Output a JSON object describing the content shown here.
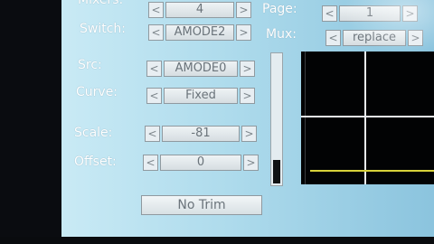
{
  "labels": {
    "mixers": "Mixers:",
    "switch": "Switch:",
    "src": "Src:",
    "curve": "Curve:",
    "scale": "Scale:",
    "offset": "Offset:",
    "page": "Page:",
    "mux": "Mux:"
  },
  "controls": {
    "mixers_value": "4",
    "switch_value": "AMODE2",
    "src_value": "AMODE0",
    "curve_value": "Fixed",
    "scale_value": "-81",
    "offset_value": "0",
    "page_value": "1",
    "mux_value": "replace"
  },
  "arrows": {
    "left": "<",
    "right": ">"
  },
  "buttons": {
    "trim": "No Trim"
  },
  "slider": {
    "level_fraction": 0.18
  },
  "colors": {
    "screen_bg": "#b5e0f0",
    "graph_bg": "#020304",
    "curve_line": "#d8d23a"
  }
}
